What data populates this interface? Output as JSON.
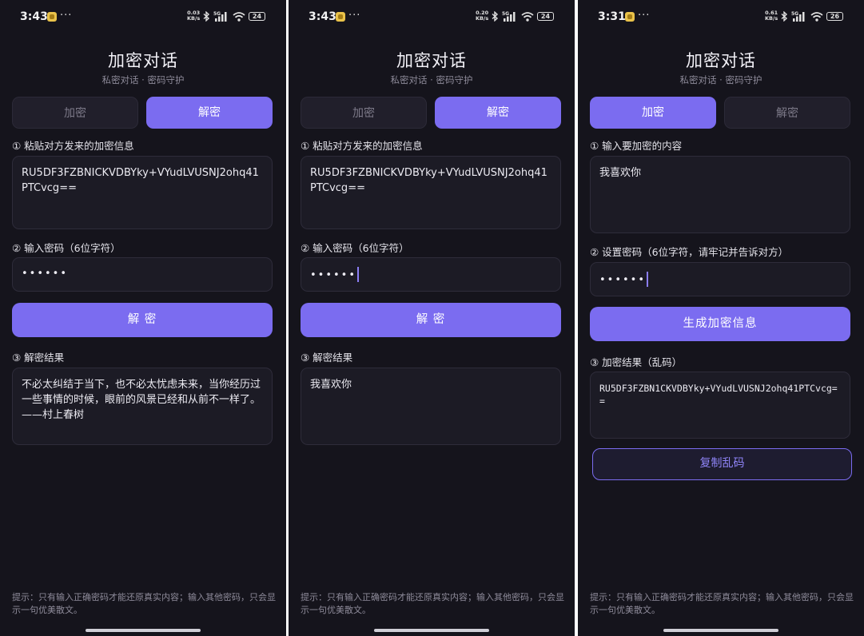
{
  "app": {
    "title": "加密对话",
    "subtitle": "私密对话 · 密码守护",
    "tab_encrypt": "加密",
    "tab_decrypt": "解密",
    "tip": "提示：只有输入正确密码才能还原真实内容；输入其他密码，只会显示一句优美散文。"
  },
  "colors": {
    "background": "#15141c",
    "accent": "#7b6cf0",
    "card": "#1c1b25",
    "muted": "#8e8b9a"
  },
  "screens": [
    {
      "status": {
        "time": "3:43",
        "dots": "···",
        "speed_value": "0.03",
        "speed_unit": "KB/s",
        "network": "5G",
        "battery": "24"
      },
      "active_tab": "解密",
      "decrypt": {
        "cipher_label": "① 粘贴对方发来的加密信息",
        "cipher_value": "RU5DF3FZBNICKVDBYky+VYudLVUSNJ2ohq41PTCvcg==",
        "password_label": "② 输入密码（6位字符）",
        "password_mask": "••••••",
        "button": "解 密",
        "result_label": "③ 解密结果",
        "result_value": "不必太纠结于当下，也不必太忧虑未来，当你经历过一些事情的时候，眼前的风景已经和从前不一样了。——村上春树"
      }
    },
    {
      "status": {
        "time": "3:43",
        "dots": "···",
        "speed_value": "0.20",
        "speed_unit": "KB/s",
        "network": "5G",
        "battery": "24"
      },
      "active_tab": "解密",
      "decrypt": {
        "cipher_label": "① 粘贴对方发来的加密信息",
        "cipher_value": "RU5DF3FZBNICKVDBYky+VYudLVUSNJ2ohq41PTCvcg==",
        "password_label": "② 输入密码（6位字符）",
        "password_mask": "••••••",
        "button": "解 密",
        "result_label": "③ 解密结果",
        "result_value": "我喜欢你"
      }
    },
    {
      "status": {
        "time": "3:31",
        "dots": "···",
        "speed_value": "0.61",
        "speed_unit": "KB/s",
        "network": "5G",
        "battery": "26"
      },
      "active_tab": "加密",
      "encrypt": {
        "plain_label": "① 输入要加密的内容",
        "plain_value": "我喜欢你",
        "password_label": "② 设置密码（6位字符，请牢记并告诉对方）",
        "password_mask": "••••••",
        "button": "生成加密信息",
        "result_label": "③ 加密结果（乱码）",
        "result_value": "RU5DF3FZBN1CKVDBYky+VYudLVUSNJ2ohq41PTCvcg==",
        "copy_button": "复制乱码"
      }
    }
  ]
}
